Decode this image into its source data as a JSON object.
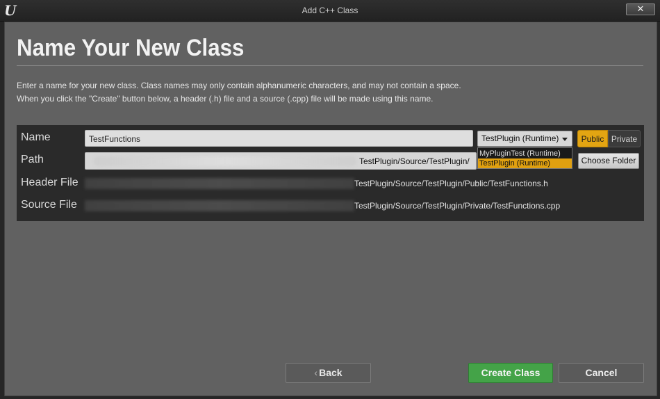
{
  "window": {
    "title": "Add C++ Class",
    "logo_text": "U",
    "close_label": "✕"
  },
  "page": {
    "heading": "Name Your New Class",
    "description_line1": "Enter a name for your new class. Class names may only contain alphanumeric characters, and may not contain a space.",
    "description_line2": "When you click the \"Create\" button below, a header (.h) file and a source (.cpp) file will be made using this name."
  },
  "form": {
    "name_label": "Name",
    "name_value": "TestFunctions",
    "path_label": "Path",
    "path_visible_suffix": "TestPlugin/Source/TestPlugin/",
    "header_label": "Header File",
    "header_visible_suffix": "TestPlugin/Source/TestPlugin/Public/TestFunctions.h",
    "source_label": "Source File",
    "source_visible_suffix": "TestPlugin/Source/TestPlugin/Private/TestFunctions.cpp",
    "module_selected": "TestPlugin (Runtime)",
    "module_options": [
      "MyPluginTest (Runtime)",
      "TestPlugin (Runtime)"
    ],
    "public_label": "Public",
    "private_label": "Private",
    "choose_folder_label": "Choose Folder"
  },
  "footer": {
    "back_label": "Back",
    "create_label": "Create Class",
    "cancel_label": "Cancel"
  },
  "colors": {
    "accent_public": "#e3a512",
    "create_green": "#44a348",
    "dropdown_highlight": "#e0a010"
  },
  "icons": {
    "close": "close-icon",
    "caret": "chevron-down-icon",
    "back": "back-arrow-icon"
  }
}
